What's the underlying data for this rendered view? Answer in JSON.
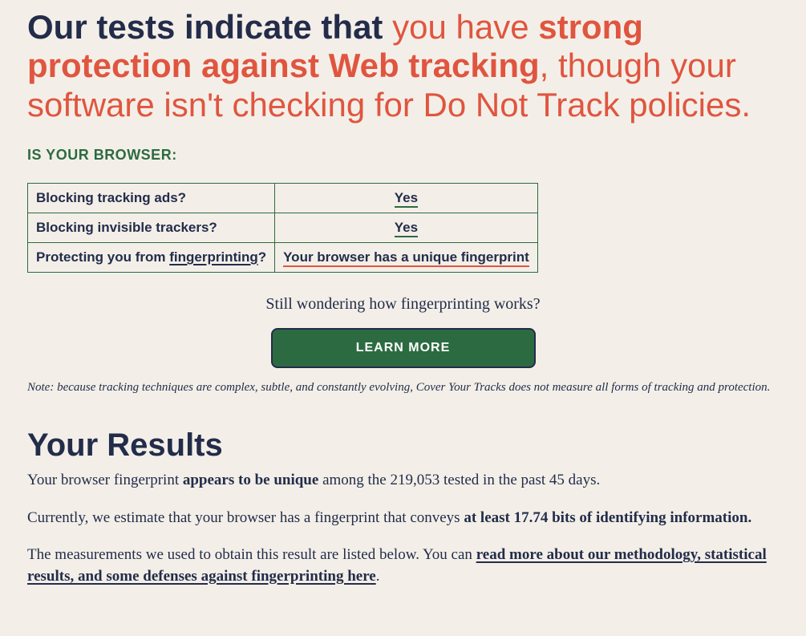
{
  "headline": {
    "prefix": "Our tests indicate that ",
    "red1": "you have ",
    "red_bold": "strong protection against Web tracking",
    "red2": ", though your software isn't checking for Do Not Track policies."
  },
  "subhead": "IS YOUR BROWSER:",
  "table": {
    "rows": [
      {
        "q_pre": "Blocking tracking ads?",
        "q_link": "",
        "q_post": "",
        "a": "Yes",
        "a_style": "green"
      },
      {
        "q_pre": "Blocking invisible trackers?",
        "q_link": "",
        "q_post": "",
        "a": "Yes",
        "a_style": "green"
      },
      {
        "q_pre": "Protecting you from ",
        "q_link": "fingerprinting",
        "q_post": "?",
        "a": "Your browser has a unique fingerprint",
        "a_style": "red"
      }
    ]
  },
  "wonder": "Still wondering how fingerprinting works?",
  "learn_btn": "LEARN MORE",
  "note": "Note: because tracking techniques are complex, subtle, and constantly evolving, Cover Your Tracks does not measure all forms of tracking and protection.",
  "results": {
    "title": "Your Results",
    "p1_pre": "Your browser fingerprint ",
    "p1_bold": "appears to be unique",
    "p1_post": " among the 219,053 tested in the past 45 days.",
    "p2_pre": "Currently, we estimate that your browser has a fingerprint that conveys ",
    "p2_bold": "at least 17.74 bits of identifying information.",
    "p3_pre": "The measurements we used to obtain this result are listed below. You can ",
    "p3_link": "read more about our methodology, statistical results, and some defenses against fingerprinting here",
    "p3_post": "."
  }
}
